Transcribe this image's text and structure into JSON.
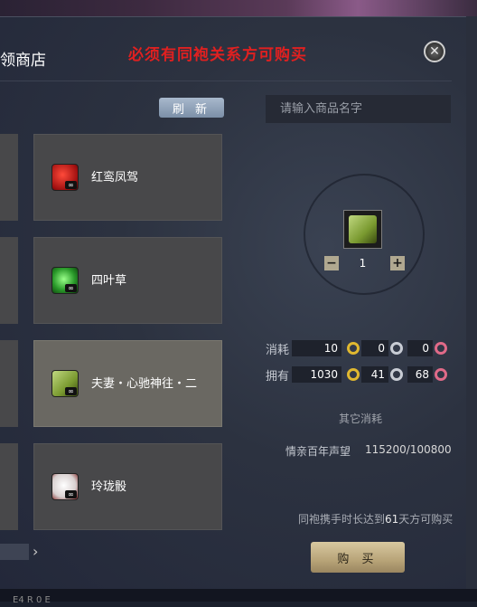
{
  "header": {
    "title": "领商店",
    "warning": "必须有同袍关系方可购买"
  },
  "shop": {
    "refresh_label": "刷 新",
    "items": [
      {
        "name": "红鸾凤驾",
        "icon": "red-carriage-icon"
      },
      {
        "name": "四叶草",
        "icon": "clover-icon"
      },
      {
        "name": "夫妻・心驰神往・二",
        "icon": "book-icon",
        "selected": true
      },
      {
        "name": "玲珑骰",
        "icon": "dice-icon"
      }
    ],
    "item_badge": "∞"
  },
  "detail": {
    "search_placeholder": "请输入商品名字",
    "quantity": "1",
    "minus_label": "−",
    "plus_label": "+",
    "cost_label": "消耗",
    "cost": {
      "gold": "10",
      "silver": "0",
      "pink": "0"
    },
    "owned_label": "拥有",
    "owned": {
      "gold": "1030",
      "silver": "41",
      "pink": "68"
    },
    "other_cost_label": "其它消耗",
    "reputation_label": "情亲百年声望",
    "reputation_value": "115200/100800",
    "condition_prefix": "同袍携手时长达到",
    "condition_days": "61",
    "condition_suffix": "天方可购买",
    "buy_label": "购 买"
  },
  "bottom_bar": {
    "text": "E4  R  0  E"
  },
  "colors": {
    "warning": "#e02020",
    "buy_button": "#b8a478",
    "refresh_button": "#8fa2ba"
  }
}
